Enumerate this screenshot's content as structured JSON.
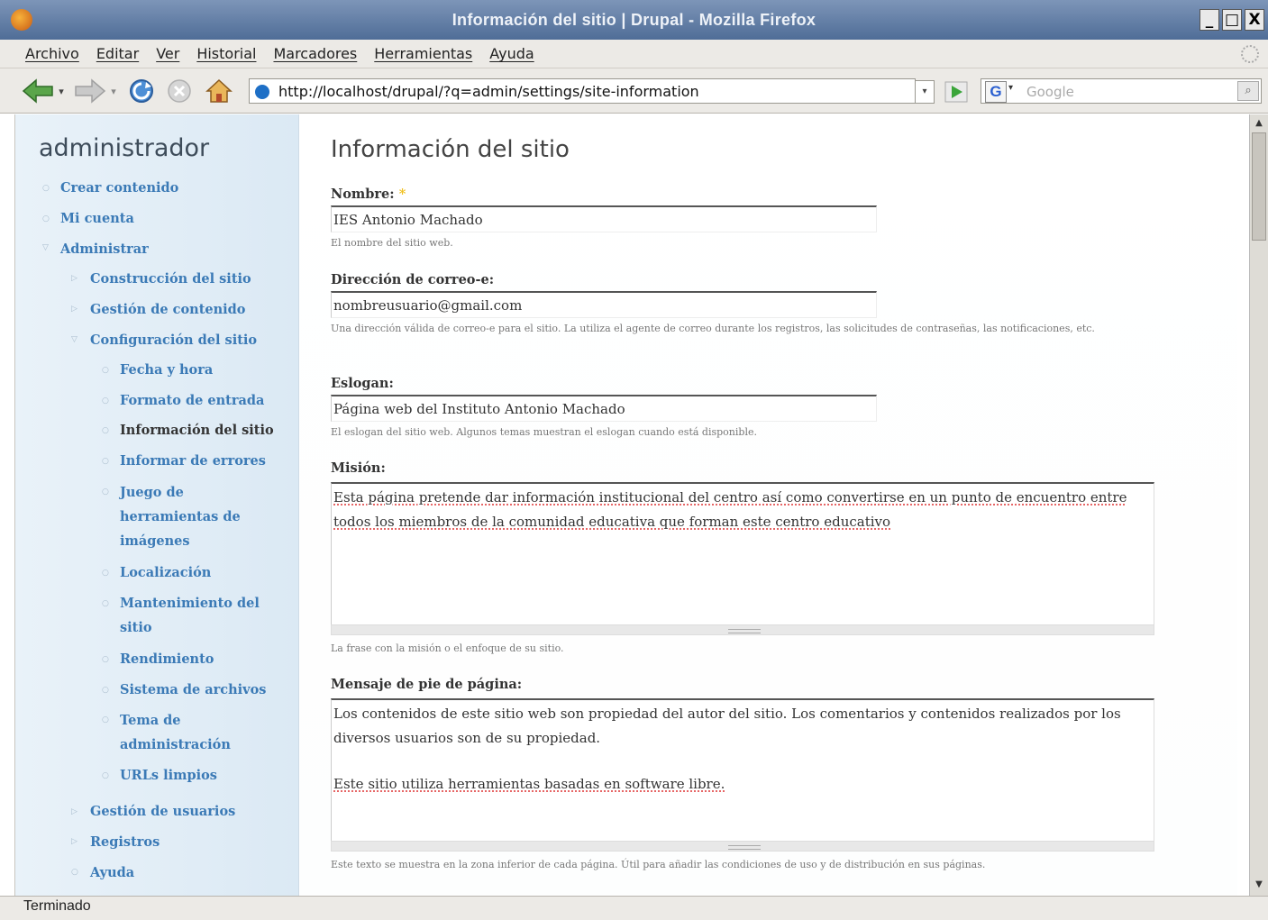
{
  "window": {
    "title": "Información del sitio | Drupal - Mozilla Firefox",
    "controls": [
      "_",
      "□",
      "X"
    ]
  },
  "menu": [
    "Archivo",
    "Editar",
    "Ver",
    "Historial",
    "Marcadores",
    "Herramientas",
    "Ayuda"
  ],
  "toolbar": {
    "url": "http://localhost/drupal/?q=admin/settings/site-information",
    "search_placeholder": "Google",
    "search_engine": "G"
  },
  "sidebar": {
    "user": "administrador",
    "items": [
      {
        "label": "Crear contenido"
      },
      {
        "label": "Mi cuenta"
      },
      {
        "label": "Administrar"
      },
      {
        "label": "Construcción del sitio"
      },
      {
        "label": "Gestión de contenido"
      },
      {
        "label": "Configuración del sitio"
      },
      {
        "label": "Fecha y hora"
      },
      {
        "label": "Formato de entrada"
      },
      {
        "label": "Información del sitio"
      },
      {
        "label": "Informar de errores"
      },
      {
        "label": "Juego de herramientas de imágenes"
      },
      {
        "label": "Localización"
      },
      {
        "label": "Mantenimiento del sitio"
      },
      {
        "label": "Rendimiento"
      },
      {
        "label": "Sistema de archivos"
      },
      {
        "label": "Tema de administración"
      },
      {
        "label": "URLs limpios"
      },
      {
        "label": "Gestión de usuarios"
      },
      {
        "label": "Registros"
      },
      {
        "label": "Ayuda"
      }
    ]
  },
  "main": {
    "title": "Información del sitio",
    "name": {
      "label": "Nombre:",
      "required": "*",
      "value": "IES Antonio Machado",
      "help": "El nombre del sitio web."
    },
    "email": {
      "label": "Dirección de correo-e:",
      "value": "nombreusuario@gmail.com",
      "help": "Una dirección válida de correo-e para el sitio. La utiliza el agente de correo durante los registros, las solicitudes de contraseñas, las notificaciones, etc."
    },
    "slogan": {
      "label": "Eslogan:",
      "value": "Página web del Instituto Antonio Machado",
      "help": "El eslogan del sitio web. Algunos temas muestran el eslogan cuando está disponible."
    },
    "mission": {
      "label": "Misión:",
      "value": "Esta página pretende dar información institucional del centro así como convertirse en un punto de encuentro entre todos los miembros de la comunidad educativa  que forman este centro educativo",
      "help": "La frase con la misión o el enfoque de su sitio."
    },
    "footer": {
      "label": "Mensaje de pie de página:",
      "line1": "Los contenidos de este sitio web son propiedad del autor del sitio. Los comentarios y contenidos realizados por los diversos usuarios son de su propiedad.",
      "line2": "Este sitio utiliza herramientas basadas en software libre.",
      "help": "Este texto se muestra en la zona inferior de cada página. Útil para añadir las condiciones de uso y de distribución en sus páginas."
    }
  },
  "status": "Terminado"
}
